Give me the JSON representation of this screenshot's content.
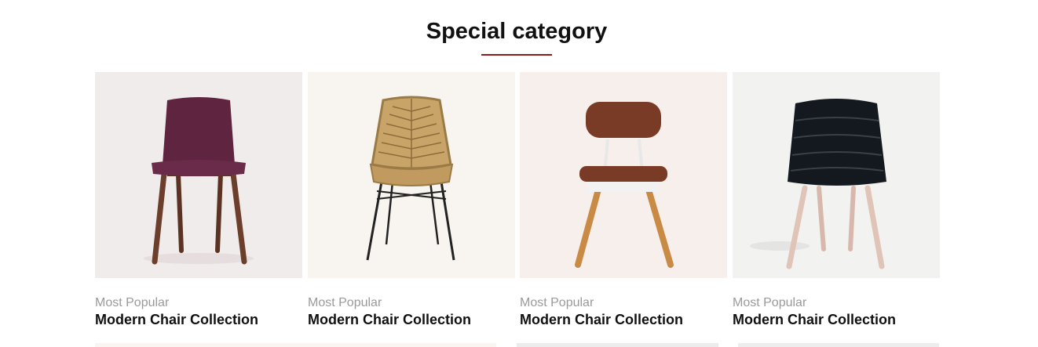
{
  "section": {
    "title": "Special category",
    "accent_color": "#8b1a1a"
  },
  "cards": [
    {
      "eyebrow": "Most Popular",
      "name": "Modern Chair Collection",
      "bg": "#f1ecec",
      "image": "purple-upholstered-chair"
    },
    {
      "eyebrow": "Most Popular",
      "name": "Modern Chair Collection",
      "bg": "#f8f4ef",
      "image": "rattan-wire-chair"
    },
    {
      "eyebrow": "Most Popular",
      "name": "Modern Chair Collection",
      "bg": "#f7efec",
      "image": "brown-leather-wood-chair"
    },
    {
      "eyebrow": "Most Popular",
      "name": "Modern Chair Collection",
      "bg": "#f2f2f0",
      "image": "black-channel-tufted-chair"
    }
  ]
}
